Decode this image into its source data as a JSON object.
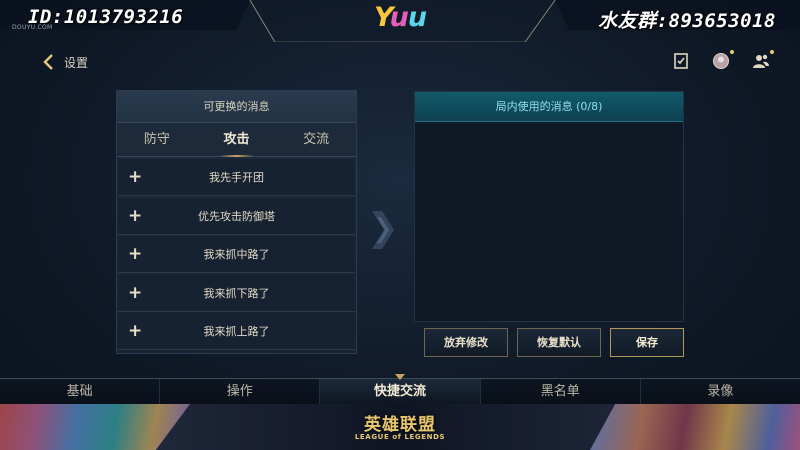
{
  "overlay": {
    "id_text": "ID:1013793216",
    "brand_text": "DOUYU.COM",
    "logo_text": [
      "Y",
      "u",
      "u"
    ],
    "fan_group_text": "水友群:893653018"
  },
  "header": {
    "back_label": "设置",
    "icons": [
      "task-icon",
      "avatar-icon",
      "friends-icon"
    ]
  },
  "left_panel": {
    "title": "可更换的消息",
    "tabs": [
      "防守",
      "攻击",
      "交流"
    ],
    "active_tab": 1,
    "messages": [
      "我先手开团",
      "优先攻击防御塔",
      "我来抓中路了",
      "我来抓下路了",
      "我来抓上路了"
    ]
  },
  "right_panel": {
    "title": "局内使用的消息 (0/8)"
  },
  "buttons": {
    "discard": "放弃修改",
    "restore": "恢复默认",
    "save": "保存"
  },
  "bottom_nav": {
    "items": [
      "基础",
      "操作",
      "快捷交流",
      "黑名单",
      "录像"
    ],
    "active": 2
  },
  "banner": {
    "title_cn": "英雄联盟",
    "title_en": "LEAGUE of LEGENDS"
  },
  "colors": {
    "accent_gold": "#c9a45c",
    "panel_title_teal": "#125a6a"
  }
}
